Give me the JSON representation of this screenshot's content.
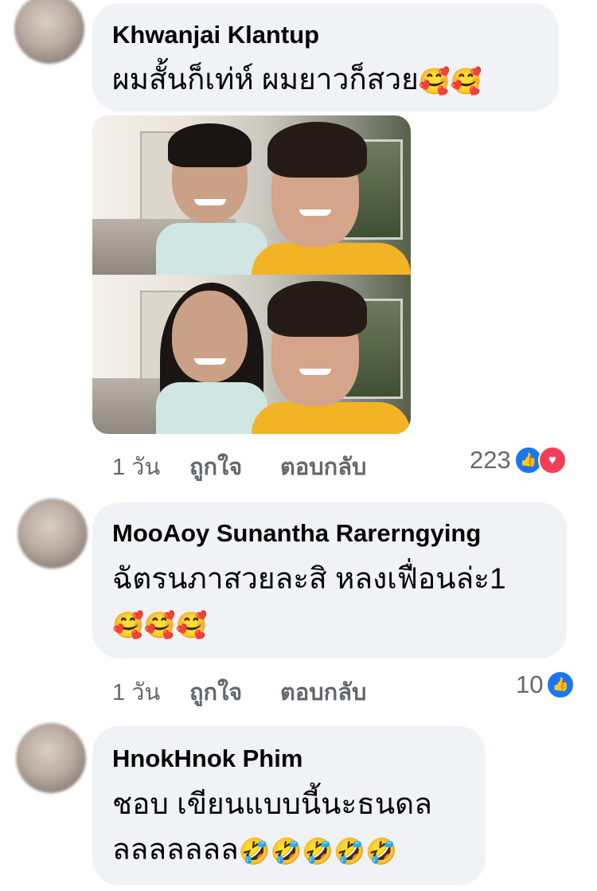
{
  "comments": [
    {
      "name": "Khwanjai Klantup",
      "text": "ผมสั้นก็เท่ห์ ผมยาวก็สวย",
      "emojis": "🥰🥰",
      "time": "1 วัน",
      "like_label": "ถูกใจ",
      "reply_label": "ตอบกลับ",
      "reaction_count": "223",
      "reactions": [
        "like-icon",
        "love-icon"
      ]
    },
    {
      "name": "MooAoy Sunantha Rarerngying",
      "text_line1": "ฉัตรนภาสวยละสิ หลงเฟื่อนล่ะ1",
      "emojis": "🥰🥰🥰",
      "time": "1 วัน",
      "like_label": "ถูกใจ",
      "reply_label": "ตอบกลับ",
      "reaction_count": "10",
      "reactions": [
        "like-icon"
      ]
    },
    {
      "name": "HnokHnok Phim",
      "text_line1": "ชอบ เขียนแบบนี้นะธนดล",
      "text_line2": "ลลลลลลล",
      "emojis": "🤣🤣🤣🤣🤣"
    }
  ],
  "colors": {
    "bubble": "#f0f2f5",
    "meta_text": "#65676b",
    "like_blue": "#1877f2",
    "love_red": "#f33e58"
  }
}
